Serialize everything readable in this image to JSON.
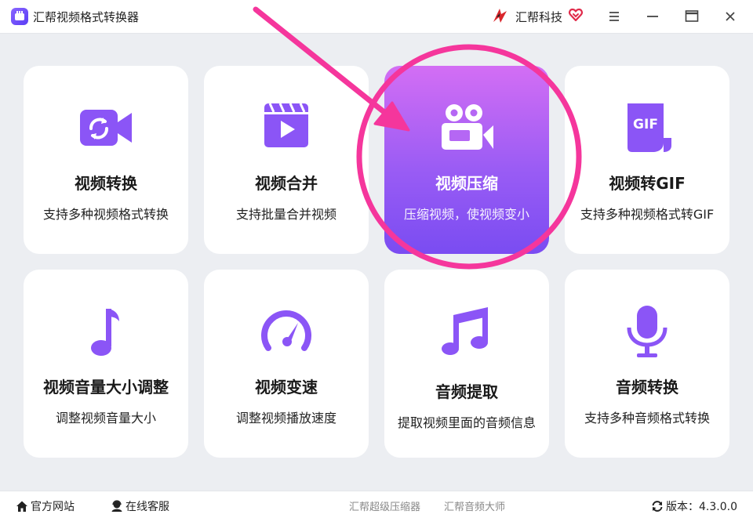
{
  "app": {
    "title": "汇帮视频格式转换器",
    "brand": "汇帮科技"
  },
  "colors": {
    "accent": "#8b55f6",
    "highlight": "#f5369c",
    "active_card_top": "#d36ef4",
    "active_card_bottom": "#7a4cf2"
  },
  "cards": [
    {
      "title": "视频转换",
      "desc": "支持多种视频格式转换",
      "icon": "video-convert-icon"
    },
    {
      "title": "视频合并",
      "desc": "支持批量合并视频",
      "icon": "video-merge-icon"
    },
    {
      "title": "视频压缩",
      "desc": "压缩视频，使视频变小",
      "icon": "video-camera-icon",
      "active": true
    },
    {
      "title": "视频转GIF",
      "desc": "支持多种视频格式转GIF",
      "icon": "gif-icon"
    },
    {
      "title": "视频音量大小调整",
      "desc": "调整视频音量大小",
      "icon": "music-note-icon"
    },
    {
      "title": "视频变速",
      "desc": "调整视频播放速度",
      "icon": "speedometer-icon"
    },
    {
      "title": "音频提取",
      "desc": "提取视频里面的音频信息",
      "icon": "music-notes-icon"
    },
    {
      "title": "音频转换",
      "desc": "支持多种音频格式转换",
      "icon": "microphone-icon"
    }
  ],
  "footer": {
    "website": "官方网站",
    "support": "在线客服",
    "links": [
      "汇帮超级压缩器",
      "汇帮音频大师"
    ],
    "version": "版本：4.3.0.0"
  }
}
